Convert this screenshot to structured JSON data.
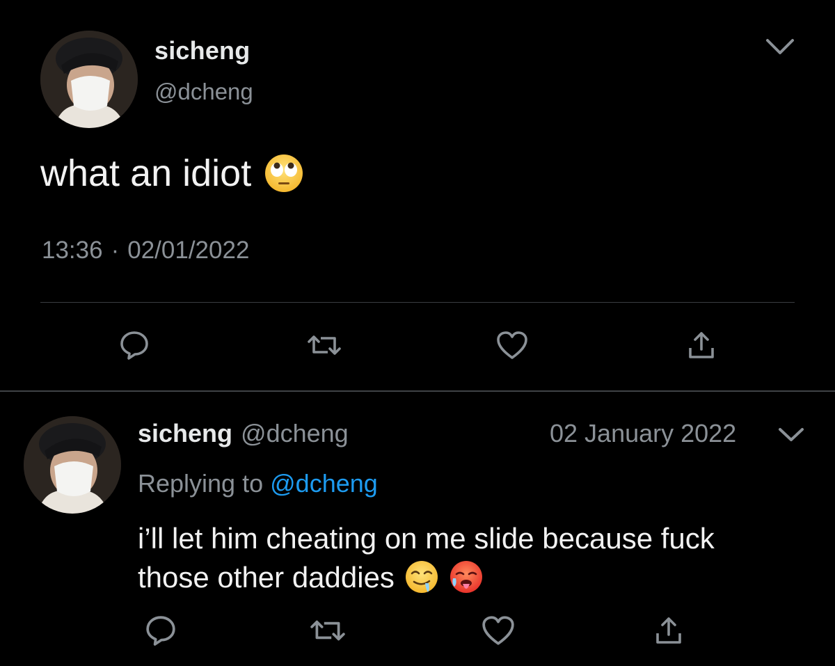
{
  "main_tweet": {
    "display_name": "sicheng",
    "handle": "@dcheng",
    "text": "what an idiot",
    "emoji": "face-with-rolling-eyes",
    "time": "13:36",
    "separator": "·",
    "date": "02/01/2022"
  },
  "reply_tweet": {
    "display_name": "sicheng",
    "handle": "@dcheng",
    "date": "02 January 2022",
    "replying_prefix": "Replying to",
    "replying_to": "@dcheng",
    "text_line1": "i’ll let him cheating on me slide because fuck",
    "text_line2": "those other daddies",
    "emojis": [
      "drooling-face",
      "hot-face"
    ]
  },
  "actions": [
    "reply-icon",
    "retweet-icon",
    "like-icon",
    "share-icon"
  ],
  "colors": {
    "background": "#000000",
    "primary_text": "#e7e9ea",
    "secondary_text": "#8b9197",
    "link": "#1d9bf0",
    "divider": "#3a3d41"
  }
}
